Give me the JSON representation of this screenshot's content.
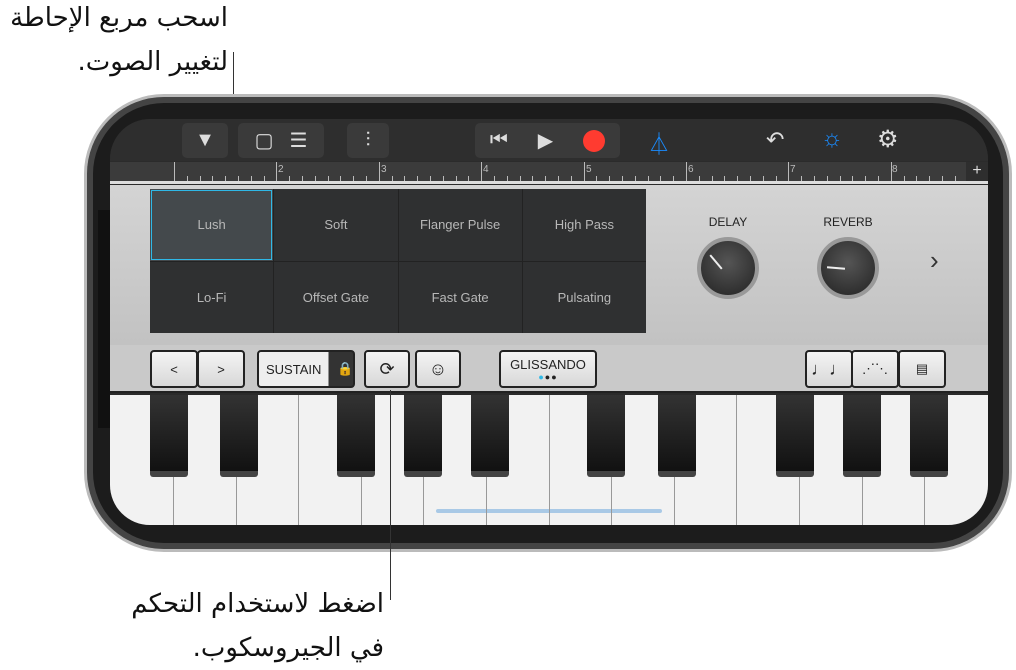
{
  "annotations": {
    "top": [
      "اسحب مربع الإحاطة",
      "لتغيير الصوت."
    ],
    "bottom": [
      "اضغط لاستخدام التحكم",
      "في الجيروسكوب."
    ]
  },
  "toolbar": {
    "icons": [
      "triangle-down",
      "browser",
      "tracks",
      "mixer",
      "rewind",
      "play",
      "record",
      "metronome",
      "undo",
      "brightness",
      "settings"
    ],
    "record_color": "#ff3b30",
    "accent": "#1a8cff"
  },
  "ruler": {
    "numbers": [
      "2",
      "3",
      "4",
      "5",
      "6",
      "7",
      "8"
    ],
    "add": "+"
  },
  "pads": [
    "Lush",
    "Soft",
    "Flanger Pulse",
    "High Pass",
    "Lo-Fi",
    "Offset Gate",
    "Fast Gate",
    "Pulsating"
  ],
  "selected_pad": "Lush",
  "knobs": {
    "delay": "DELAY",
    "reverb": "REVERB"
  },
  "controls": {
    "prev": "<",
    "next": ">",
    "sustain": "SUSTAIN",
    "glissando": "GLISSANDO",
    "next_panel": "›"
  }
}
